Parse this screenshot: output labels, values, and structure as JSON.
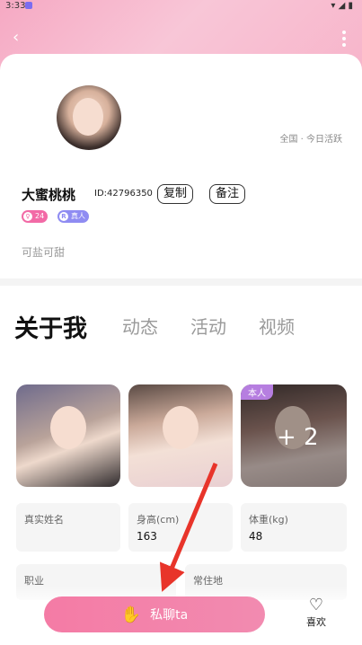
{
  "status": {
    "time": "3:33"
  },
  "profile": {
    "location": "全国 · 今日活跃",
    "name": "大蜜桃桃",
    "id_text": "ID:42796350",
    "copy_label": "复制",
    "note_label": "备注",
    "badges": {
      "age": "24",
      "real": "真人"
    },
    "bio": "可盐可甜"
  },
  "tabs": [
    "关于我",
    "动态",
    "活动",
    "视频"
  ],
  "photos": {
    "third_tag": "本人",
    "more_count": "+ 2"
  },
  "info": [
    {
      "label": "真实姓名",
      "value": ""
    },
    {
      "label": "身高(cm)",
      "value": "163"
    },
    {
      "label": "体重(kg)",
      "value": "48"
    },
    {
      "label": "职业",
      "value": ""
    },
    {
      "label": "常住地",
      "value": ""
    }
  ],
  "actions": {
    "chat_label": "私聊ta",
    "like_label": "喜欢"
  },
  "colors": {
    "accent": "#f47ba5",
    "arrow": "#e8342a"
  }
}
